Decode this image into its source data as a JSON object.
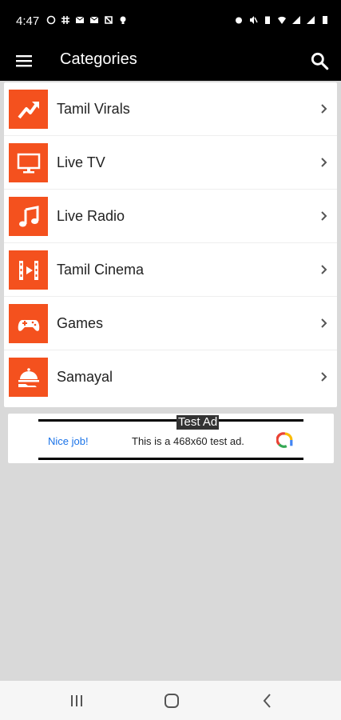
{
  "status_bar": {
    "time": "4:47"
  },
  "app_bar": {
    "title": "Categories",
    "menu_icon": "hamburger-menu-icon",
    "search_icon": "search-icon"
  },
  "categories": [
    {
      "label": "Tamil Virals",
      "icon": "trending-up-icon"
    },
    {
      "label": "Live TV",
      "icon": "tv-icon"
    },
    {
      "label": "Live Radio",
      "icon": "music-note-icon"
    },
    {
      "label": "Tamil Cinema",
      "icon": "film-icon"
    },
    {
      "label": "Games",
      "icon": "gamepad-icon"
    },
    {
      "label": "Samayal",
      "icon": "food-cloche-icon"
    }
  ],
  "ad": {
    "label": "Test Ad",
    "nice_job": "Nice job!",
    "text": "This is a 468x60 test ad."
  },
  "colors": {
    "accent": "#f4511e",
    "app_bar": "#000000",
    "background": "#d9d9d9",
    "ad_link": "#1a73e8"
  }
}
